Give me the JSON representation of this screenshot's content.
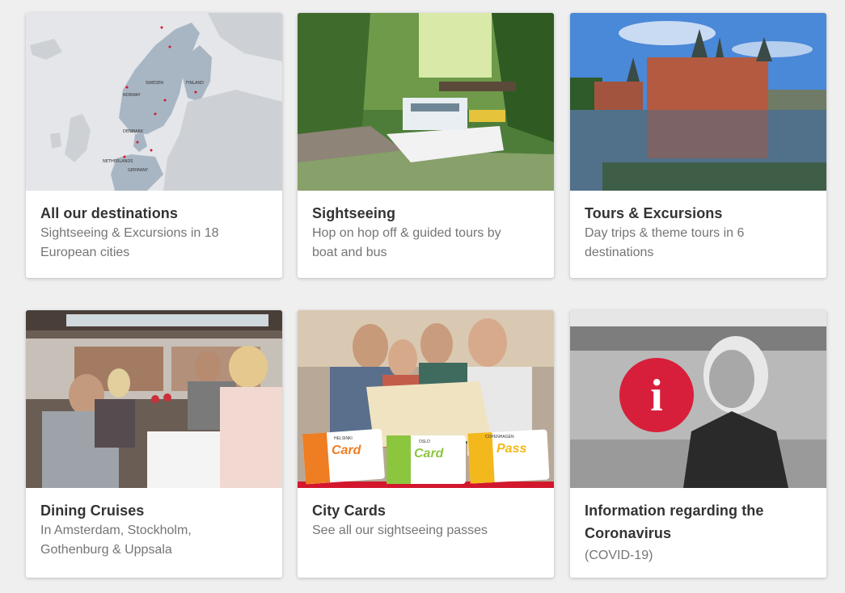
{
  "cards": [
    {
      "title": "All our destinations",
      "desc_line1": "Sightseeing & Excursions in 18",
      "desc_line2": "European cities",
      "image": "europe-map-image",
      "map_labels": [
        "SWEDEN",
        "FINLAND",
        "NORWAY",
        "DENMARK",
        "NETHERLANDS",
        "GERMANY"
      ]
    },
    {
      "title": "Sightseeing",
      "desc_line1": "Hop on hop off & guided tours by",
      "desc_line2": "boat and bus",
      "image": "canal-boat-image"
    },
    {
      "title": "Tours & Excursions",
      "desc_line1": "Day trips & theme tours in 6",
      "desc_line2": "destinations",
      "image": "castle-lake-image"
    },
    {
      "title": "Dining Cruises",
      "desc_line1": "In Amsterdam, Stockholm,",
      "desc_line2": "Gothenburg & Uppsala",
      "image": "dining-cruise-image"
    },
    {
      "title": "City Cards",
      "desc_line1": "See all our sightseeing passes",
      "image": "city-cards-image",
      "card_labels": [
        {
          "city": "HELSINKI",
          "name": "Card"
        },
        {
          "city": "OSLO",
          "name": "Card"
        },
        {
          "city": "COPENHAGEN",
          "name": "Pass"
        }
      ]
    },
    {
      "title_line1": "Information regarding the",
      "title_line2": "Coronavirus",
      "desc_line1": "(COVID-19)",
      "image": "info-coronavirus-image",
      "info_symbol": "i"
    }
  ],
  "colors": {
    "background": "#efefef",
    "title": "#333333",
    "desc": "#757575",
    "info_red": "#d71f3b",
    "city_cards_red": "#d3172c"
  }
}
